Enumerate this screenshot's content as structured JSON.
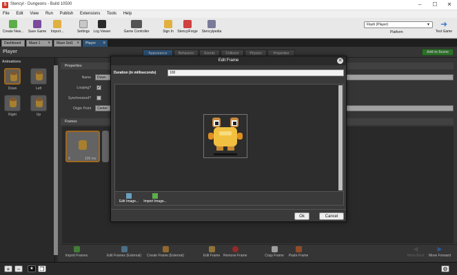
{
  "window": {
    "title": "Stencyl - Dungeons - Build 10500",
    "app_icon": "S",
    "min": "–",
    "max": "☐",
    "close": "✕"
  },
  "menu": [
    "File",
    "Edit",
    "View",
    "Run",
    "Publish",
    "Extensions",
    "Tools",
    "Help"
  ],
  "toolbar": {
    "create_new": "Create New...",
    "save_game": "Save Game",
    "import": "Import...",
    "settings": "Settings",
    "log_viewer": "Log Viewer",
    "game_controller": "Game Controller",
    "sign_in": "Sign In",
    "stencylforge": "StencylForge",
    "stencylpedia": "Stencylpedia",
    "target_select": "Flash (Player)",
    "platform": "Platform",
    "test_game": "Test Game"
  },
  "tabs": [
    {
      "label": "Dashboard"
    },
    {
      "label": "Maze 1"
    },
    {
      "label": "Maze Set1"
    },
    {
      "label": "Player"
    }
  ],
  "actor": {
    "name": "Player",
    "subtabs": [
      "Appearance",
      "Behaviors",
      "Events",
      "Collision",
      "Physics",
      "Properties"
    ],
    "add_to_scene": "Add to Scene"
  },
  "animations": {
    "header": "Animations",
    "items": [
      {
        "label": "Down"
      },
      {
        "label": "Left"
      },
      {
        "label": "Right"
      },
      {
        "label": "Up"
      }
    ]
  },
  "properties": {
    "header": "Properties",
    "name_label": "Name",
    "name_value": "Down",
    "looping_label": "Looping?",
    "looping_value": "✓",
    "synchronized_label": "Synchronized?",
    "origin_label": "Origin Point",
    "origin_value": "Center"
  },
  "frames": {
    "header": "Frames",
    "tile_index": "0",
    "tile_duration": "100 ms"
  },
  "frame_tools": {
    "import_frames": "Import Frames",
    "edit_frames_external": "Edit Frames (External)",
    "create_frame_external": "Create Frame (External)",
    "edit_frame": "Edit Frame",
    "remove_frame": "Remove Frame",
    "copy_frame": "Copy Frame",
    "paste_frame": "Paste Frame",
    "move_back": "Move Back",
    "move_forward": "Move Forward"
  },
  "status": {
    "add": "+",
    "remove": "−",
    "gear": "⚙"
  },
  "dialog": {
    "title": "Edit Frame",
    "close": "✕",
    "duration_label": "Duration (in milliseconds)",
    "duration_value": "100",
    "edit_image": "Edit Image...",
    "import_image": "Import Image...",
    "ok": "Ok",
    "cancel": "Cancel"
  },
  "colors": {
    "accent": "#3c6fa0",
    "green": "#3d9a3a",
    "selection": "#e0902a"
  }
}
